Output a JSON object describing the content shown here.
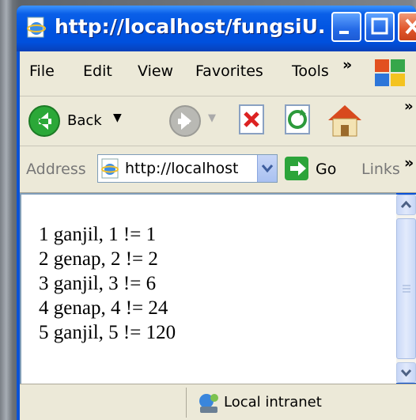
{
  "window": {
    "title": "http://localhost/fungsiU..."
  },
  "menu": {
    "items": [
      "File",
      "Edit",
      "View",
      "Favorites",
      "Tools"
    ],
    "more": "»"
  },
  "toolbar": {
    "back_label": "Back",
    "more": "»"
  },
  "address": {
    "label": "Address",
    "url": "http://localhost",
    "go_label": "Go",
    "links_label": "Links",
    "more": "»"
  },
  "content": {
    "lines": [
      "1 ganjil, 1 != 1",
      "2 genap, 2 != 2",
      "3 ganjil, 3 != 6",
      "4 genap, 4 != 24",
      "5 ganjil, 5 != 120"
    ]
  },
  "status": {
    "zone": "Local intranet"
  },
  "colors": {
    "title_blue": "#0a52d6",
    "chrome": "#ece9d8",
    "close_red": "#e0552a",
    "go_green": "#2ca43a"
  }
}
